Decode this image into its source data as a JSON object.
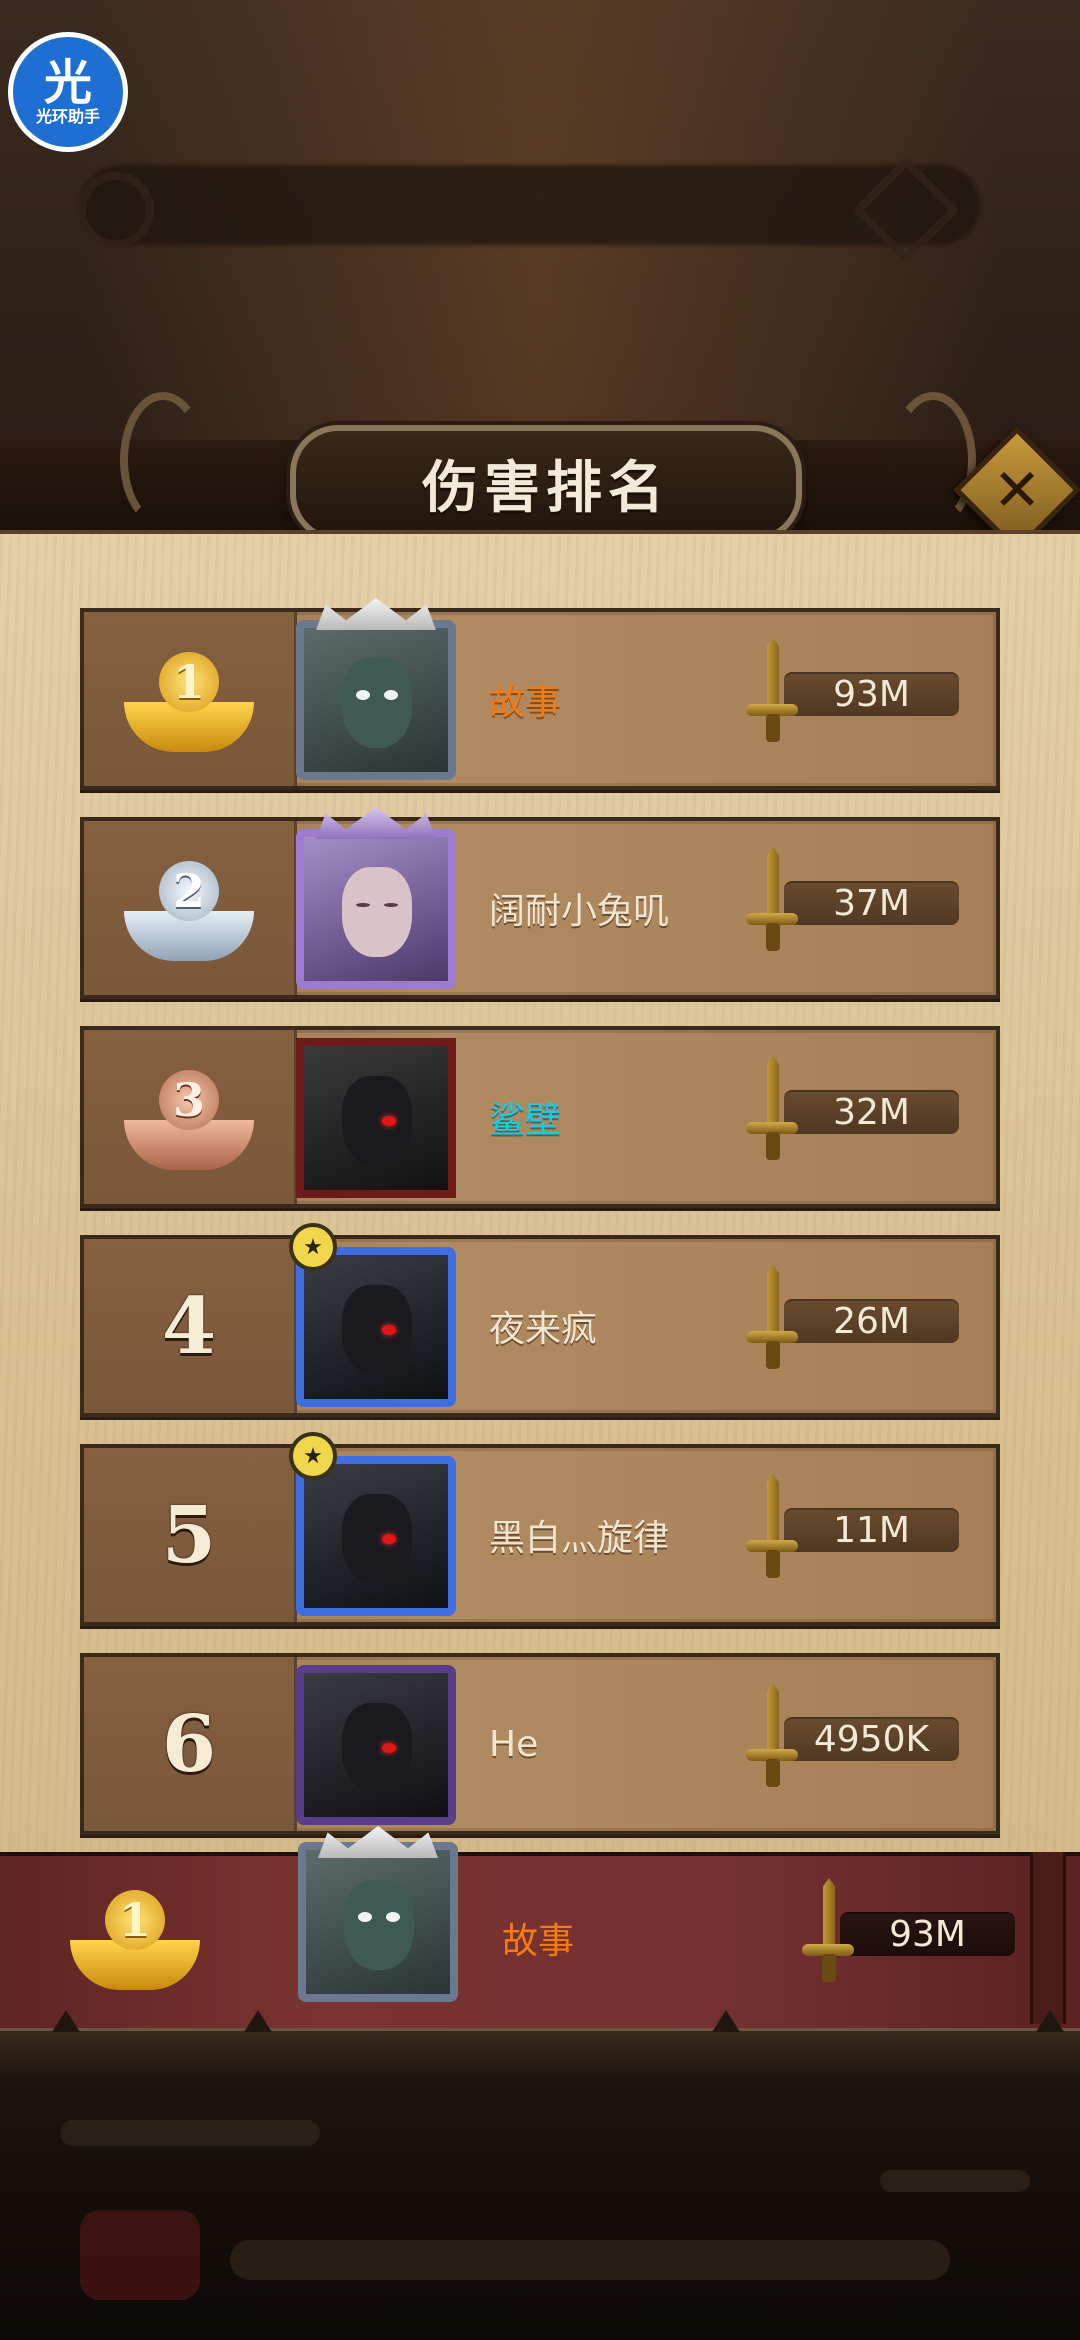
{
  "watermark": {
    "big": "光",
    "small": "光环助手"
  },
  "header": {
    "title": "伤害排名",
    "close_label": "✕"
  },
  "rankings": [
    {
      "rank": "1",
      "name": "故事",
      "score": "93M"
    },
    {
      "rank": "2",
      "name": "阔耐小兔叽",
      "score": "37M"
    },
    {
      "rank": "3",
      "name": "鲨壁",
      "score": "32M"
    },
    {
      "rank": "4",
      "name": "夜来疯",
      "score": "26M"
    },
    {
      "rank": "5",
      "name": "黑白灬旋律",
      "score": "11M"
    },
    {
      "rank": "6",
      "name": "He",
      "score": "4950K"
    }
  ],
  "self": {
    "rank": "1",
    "name": "故事",
    "score": "93M"
  },
  "colors": {
    "name_orange": "#f47a12",
    "name_cyan": "#14cde8",
    "gold": "#e6a820",
    "silver": "#b8c6d2",
    "bronze": "#c68466"
  }
}
